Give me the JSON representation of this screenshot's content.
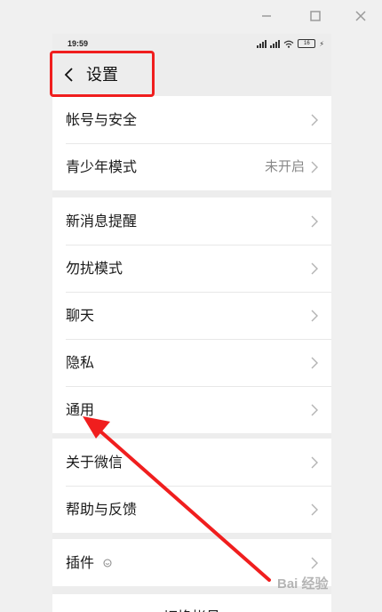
{
  "window": {
    "minimize_icon": "minimize-icon",
    "maximize_icon": "maximize-icon",
    "close_icon": "close-icon"
  },
  "status_bar": {
    "time": "19:59",
    "battery": "16"
  },
  "nav": {
    "title": "设置"
  },
  "groups": [
    {
      "items": [
        {
          "label": "帐号与安全"
        },
        {
          "label": "青少年模式",
          "value": "未开启"
        }
      ]
    },
    {
      "items": [
        {
          "label": "新消息提醒"
        },
        {
          "label": "勿扰模式"
        },
        {
          "label": "聊天"
        },
        {
          "label": "隐私"
        },
        {
          "label": "通用"
        }
      ]
    },
    {
      "items": [
        {
          "label": "关于微信"
        },
        {
          "label": "帮助与反馈"
        }
      ]
    },
    {
      "items": [
        {
          "label": "插件"
        }
      ]
    }
  ],
  "bottom": {
    "switch_account": "切换帐号"
  },
  "annotation": {
    "color": "#f01e1e"
  },
  "watermark": {
    "text": "Bai 经验"
  }
}
